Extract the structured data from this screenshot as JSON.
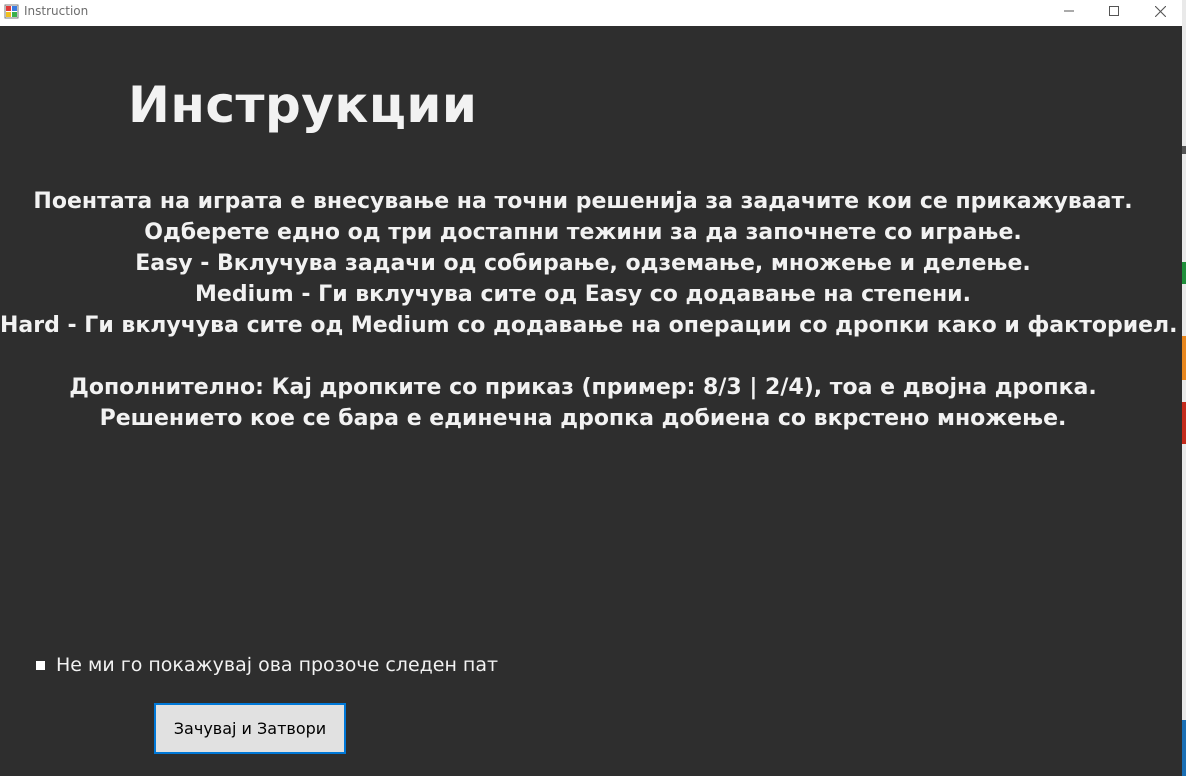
{
  "window": {
    "title": "Instruction",
    "controls": {
      "minimize": "—",
      "maximize": "☐",
      "close": "✕"
    }
  },
  "main": {
    "heading": "Инструкции",
    "lines": [
      "Поентата на играта е внесување на точни решенија за задачите кои се прикажуваат.",
      "Одберете едно од три достапни тежини за да започнете со играње.",
      "Easy - Вклучува задачи од собирање, одземање, множење и делење.",
      "Medium - Ги вклучува сите од Easy со додавање на степени.",
      "Hard - Ги вклучува сите од Medium со додавање на операции со дропки како и факториел."
    ],
    "extra_lines": [
      "Дополнително: Кај дропките со приказ (пример: 8/3 | 2/4), тоа е двојна дропка.",
      "Решението кое се бара е единечна дропка добиена со вкрстено множење."
    ]
  },
  "checkbox": {
    "label": "Не ми го покажувај ова прозоче следен пат",
    "checked": false
  },
  "buttons": {
    "save_close": "Зачувај и Затвори"
  },
  "colors": {
    "background": "#2e2e2e",
    "text": "#f2f2f2",
    "button_border": "#0078d7"
  }
}
